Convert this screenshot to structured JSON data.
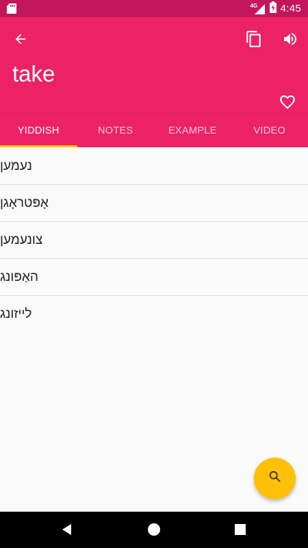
{
  "status_bar": {
    "time": "4:45",
    "network_label": "4G",
    "icons": [
      "sd-card-icon",
      "signal-icon",
      "battery-charging-icon"
    ]
  },
  "app_bar": {
    "title": "take",
    "icons": [
      "back-arrow-icon",
      "copy-icon",
      "speaker-icon",
      "heart-outline-icon"
    ],
    "colors": {
      "primary": "#ec2166",
      "primary_dark": "#c2185b",
      "accent": "#ffc107"
    }
  },
  "tabs": [
    {
      "label": "YIDDISH",
      "active": true
    },
    {
      "label": "NOTES",
      "active": false
    },
    {
      "label": "EXAMPLE",
      "active": false
    },
    {
      "label": "VIDEO",
      "active": false
    }
  ],
  "translations": [
    "נעמען",
    "אָפּטראָגן",
    "צונעמען",
    "האַפּונג",
    "לייזונג"
  ],
  "fab": {
    "icon": "search-icon"
  },
  "nav_bar": {
    "icons": [
      "nav-back-icon",
      "nav-home-icon",
      "nav-recents-icon"
    ]
  }
}
